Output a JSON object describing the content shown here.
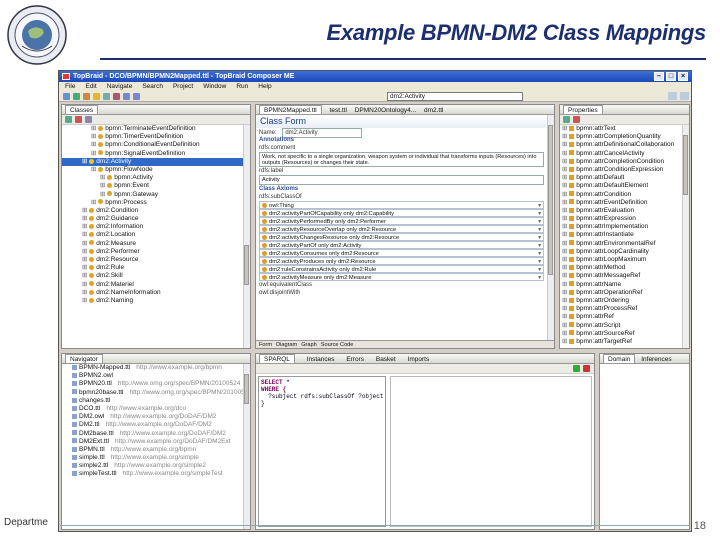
{
  "slide": {
    "title": "Example BPMN-DM2 Class Mappings",
    "footer": "Departme",
    "page_number": "18"
  },
  "window": {
    "title": "TopBraid - DCO/BPMN/BPMN2Mapped.ttl - TopBraid Composer ME",
    "menu": [
      "File",
      "Edit",
      "Navigate",
      "Search",
      "Project",
      "Window",
      "Run",
      "Help"
    ],
    "resource_combo": "dm2:Activity"
  },
  "classes_panel": {
    "tab_label": "Classes",
    "rows": [
      {
        "indent": 3,
        "text": "bpmn:TerminateEventDefinition",
        "icon": "class",
        "hl": false
      },
      {
        "indent": 3,
        "text": "bpmn:TimerEventDefinition",
        "icon": "class",
        "hl": false
      },
      {
        "indent": 3,
        "text": "bpmn:ConditionalEventDefinition",
        "icon": "class",
        "hl": false
      },
      {
        "indent": 3,
        "text": "bpmn:SignalEventDefinition",
        "icon": "class",
        "hl": false
      },
      {
        "indent": 2,
        "text": "dm2:Activity",
        "icon": "class",
        "hl": true
      },
      {
        "indent": 3,
        "text": "bpmn:FlowNode",
        "icon": "class",
        "hl": false
      },
      {
        "indent": 4,
        "text": "bpmn:Activity",
        "icon": "class",
        "hl": false
      },
      {
        "indent": 4,
        "text": "bpmn:Event",
        "icon": "class",
        "hl": false
      },
      {
        "indent": 4,
        "text": "bpmn:Gateway",
        "icon": "class",
        "hl": false
      },
      {
        "indent": 3,
        "text": "bpmn:Process",
        "icon": "class",
        "hl": false
      },
      {
        "indent": 2,
        "text": "dm2:Condition",
        "icon": "class",
        "hl": false
      },
      {
        "indent": 2,
        "text": "dm2:Guidance",
        "icon": "class",
        "hl": false
      },
      {
        "indent": 2,
        "text": "dm2:Information",
        "icon": "class",
        "hl": false
      },
      {
        "indent": 2,
        "text": "dm2:Location",
        "icon": "class",
        "hl": false
      },
      {
        "indent": 2,
        "text": "dm2:Measure",
        "icon": "class",
        "hl": false
      },
      {
        "indent": 2,
        "text": "dm2:Performer",
        "icon": "class",
        "hl": false
      },
      {
        "indent": 2,
        "text": "dm2:Resource",
        "icon": "class",
        "hl": false
      },
      {
        "indent": 2,
        "text": "dm2:Rule",
        "icon": "class",
        "hl": false
      },
      {
        "indent": 2,
        "text": "dm2:Skill",
        "icon": "class",
        "hl": false
      },
      {
        "indent": 2,
        "text": "dm2:Materiel",
        "icon": "class",
        "hl": false
      },
      {
        "indent": 2,
        "text": "dm2:NameInformation",
        "icon": "class",
        "hl": false
      },
      {
        "indent": 2,
        "text": "dm2:Naming",
        "icon": "class",
        "hl": false
      }
    ]
  },
  "editor": {
    "tabs": [
      "BPMN2Mapped.ttl",
      "test.ttl",
      "DPMN20Ontology4...",
      "dm2.ttl"
    ],
    "form_title": "Class Form",
    "name_label": "Name:",
    "name_value": "dm2:Activity",
    "annotations_header": "Annotations",
    "comment_label": "rdfs:comment",
    "comment_text": "Work, not specific to a single organization, weapon system or individual that transforms inputs (Resources) into outputs (Resources) or changes their state.",
    "label_label": "rdfs:label",
    "label_value": "Activity",
    "class_axioms_header": "Class Axioms",
    "subclass_label": "rdfs:subClassOf",
    "subclass_rows": [
      "owl:Thing",
      "dm2:activityPartOfCapability only dm2:Capability",
      "dm2:activityPerformedBy only dm2:Performer",
      "dm2:activityResourceOverlap only dm2:Resource",
      "dm2:activityChangesResource only dm2:Resource",
      "dm2:activityPartOf only dm2:Activity",
      "dm2:activityConsumes only dm2:Resource",
      "dm2:activityProduces only dm2:Resource",
      "dm2:ruleConstrainsActivity only dm2:Rule",
      "dm2:activityMeasure only dm2:Measure"
    ],
    "equivalent_label": "owl:equivalentClass",
    "disjoint_label": "owl:disjointWith",
    "bottom_tabs": [
      "Form",
      "Diagram",
      "Graph",
      "Source Code"
    ]
  },
  "properties_panel": {
    "tab_label": "Properties",
    "rows": [
      "bpmn:attrText",
      "bpmn:attrCompletionQuantity",
      "bpmn:attrDefinitionalCollaboration",
      "bpmn:attrCancelActivity",
      "bpmn:attrCompletionCondition",
      "bpmn:attrConditionExpression",
      "bpmn:attrDefault",
      "bpmn:attrDefaultElement",
      "bpmn:attrCondition",
      "bpmn:attrEventDefinition",
      "bpmn:attrEvaluation",
      "bpmn:attrExpression",
      "bpmn:attrImplementation",
      "bpmn:attrInstantiate",
      "bpmn:attrEnvironmentalRef",
      "bpmn:attrLoopCardinality",
      "bpmn:attrLoopMaximum",
      "bpmn:attrMethod",
      "bpmn:attrMessageRef",
      "bpmn:attrName",
      "bpmn:attrOperationRef",
      "bpmn:attrOrdering",
      "bpmn:attrProcessRef",
      "bpmn:attrRef",
      "bpmn:attrScript",
      "bpmn:attrSourceRef",
      "bpmn:attrTargetRef"
    ]
  },
  "navigator": {
    "tab_label": "Navigator",
    "rows": [
      {
        "name": "BPMN-Mapped.ttl",
        "uri": "http://www.example.org/bpmn"
      },
      {
        "name": "BPMN2.owl",
        "uri": ""
      },
      {
        "name": "BPMN20.ttl",
        "uri": "http://www.omg.org/spec/BPMN/20100524"
      },
      {
        "name": "bpmn20base.ttl",
        "uri": "http://www.omg.org/spec/BPMN/20100524"
      },
      {
        "name": "changes.ttl",
        "uri": ""
      },
      {
        "name": "DCO.ttl",
        "uri": "http://www.example.org/dco"
      },
      {
        "name": "DM2.owl",
        "uri": "http://www.example.org/DoDAF/DM2"
      },
      {
        "name": "DM2.ttl",
        "uri": "http://www.example.org/DoDAF/DM2"
      },
      {
        "name": "DM2base.ttl",
        "uri": "http://www.example.org/DoDAF/DM2"
      },
      {
        "name": "DM2Ext.ttl",
        "uri": "http://www.example.org/DoDAF/DM2Ext"
      },
      {
        "name": "BPMN.ttl",
        "uri": "http://www.example.org/bpmn"
      },
      {
        "name": "simple.ttl",
        "uri": "http://www.example.org/simple"
      },
      {
        "name": "simple2.ttl",
        "uri": "http://www.example.org/simple2"
      },
      {
        "name": "simpleTest.ttl",
        "uri": "http://www.example.org/simpleTest"
      }
    ]
  },
  "sparql": {
    "tabs": [
      "SPARQL",
      "Instances",
      "Errors",
      "Basket",
      "Imports"
    ],
    "query_lines": [
      "SELECT *",
      "WHERE {",
      "  ?subject rdfs:subClassOf ?object",
      "}"
    ]
  },
  "domain_panel": {
    "tabs": [
      "Domain",
      "Inferences"
    ]
  }
}
